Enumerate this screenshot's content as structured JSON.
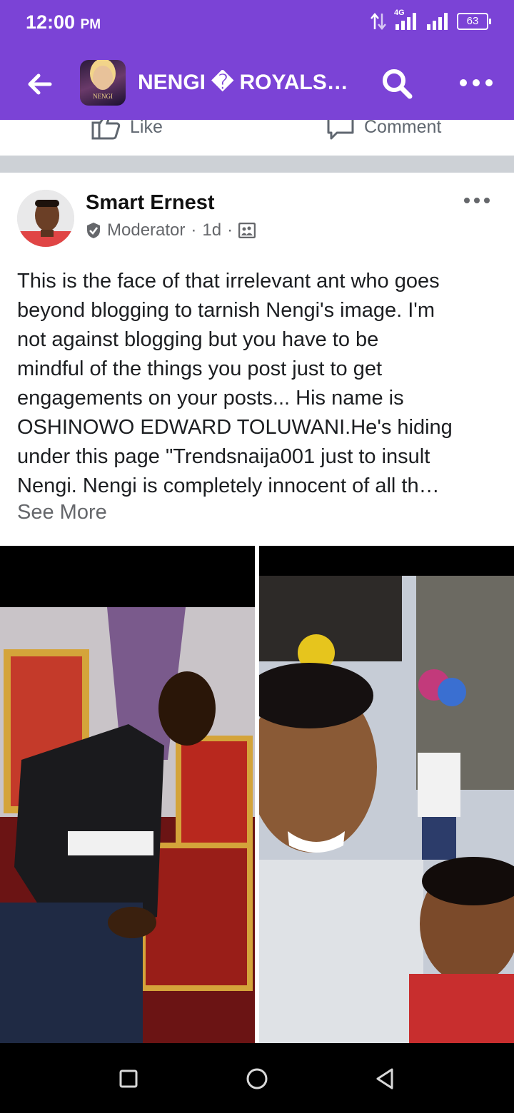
{
  "status_bar": {
    "time": "12:00",
    "ampm": "PM",
    "network": "4G",
    "battery": "63"
  },
  "app_bar": {
    "group_title": "NENGI � ROYALS…",
    "group_icon_text": "NENGI"
  },
  "previous_post_actions": {
    "like_label": "Like",
    "comment_label": "Comment"
  },
  "post": {
    "author": "Smart Ernest",
    "role": "Moderator",
    "time": "1d",
    "text_lines": [
      "This is the face of that irrelevant ant who goes",
      "beyond blogging to tarnish Nengi's image. I'm",
      "not against blogging but you have to be",
      "mindful of the things you post just to get",
      "engagements on your posts...  His name is",
      "OSHINOWO EDWARD TOLUWANI.He's hiding",
      "under this page \"Trendsnaija001 just to insult",
      "Nengi. Nengi is completely innocent of all th…"
    ],
    "see_more": "See More"
  },
  "colors": {
    "brand_purple": "#7b43d6",
    "secondary_text": "#65676b",
    "separator": "#cdd1d6"
  },
  "icons": [
    "back-arrow-icon",
    "search-icon",
    "more-dots-icon",
    "like-thumb-icon",
    "comment-bubble-icon",
    "moderator-badge-icon",
    "group-privacy-icon",
    "nav-recents-icon",
    "nav-home-icon",
    "nav-back-icon"
  ]
}
